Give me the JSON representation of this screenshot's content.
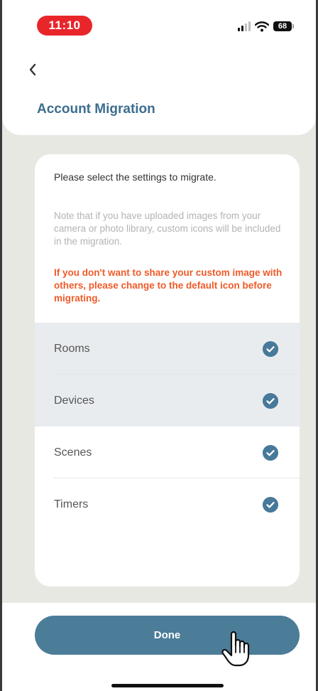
{
  "status_bar": {
    "time": "11:10",
    "battery": "68"
  },
  "header": {
    "title": "Account Migration"
  },
  "content": {
    "intro": "Please select the settings to migrate.",
    "note": "Note that if you have uploaded images from your camera or photo library, custom icons will be included in the migration.",
    "warning": "If you don't want to share your custom image with others, please change to the default icon before migrating."
  },
  "options": [
    {
      "label": "Rooms",
      "checked": true
    },
    {
      "label": "Devices",
      "checked": true
    },
    {
      "label": "Scenes",
      "checked": true
    },
    {
      "label": "Timers",
      "checked": true
    }
  ],
  "footer": {
    "done_label": "Done"
  },
  "colors": {
    "accent": "#4b7c98",
    "title": "#3c6e8f",
    "warning": "#ef5a28",
    "status_pill": "#e8262a"
  }
}
